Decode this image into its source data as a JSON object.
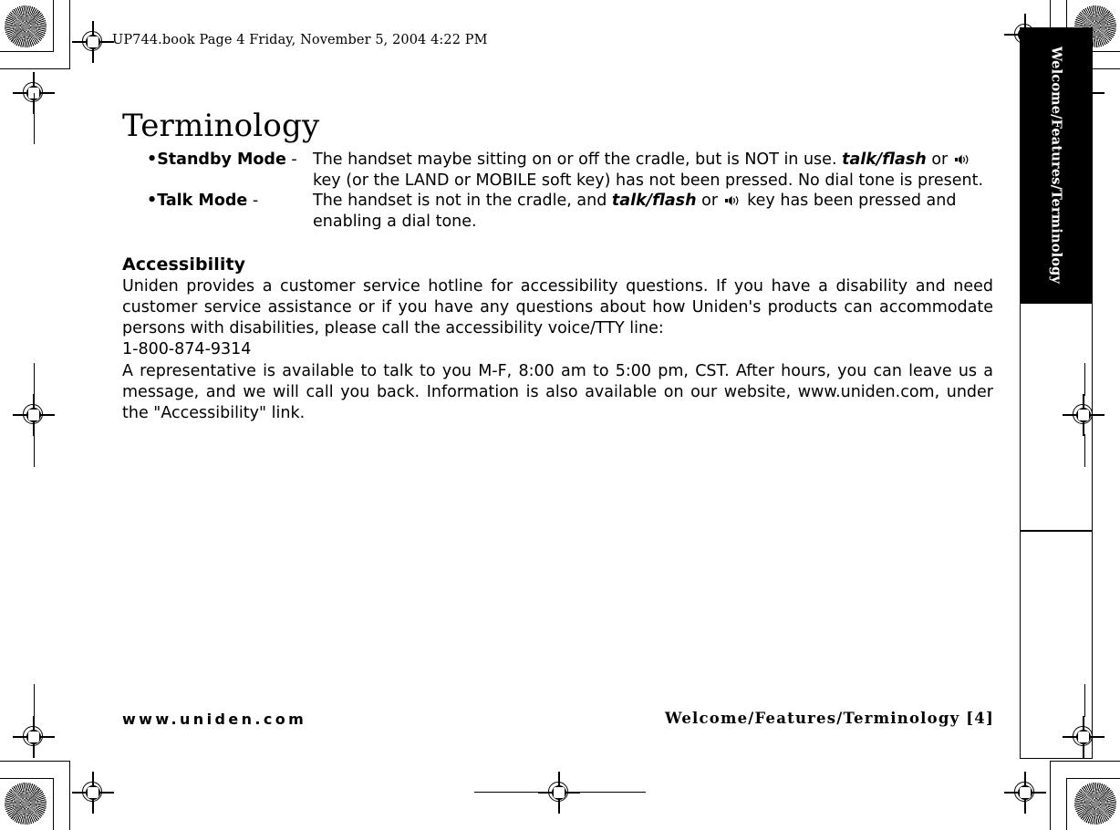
{
  "document": {
    "header_note": "UP744.book  Page 4  Friday, November 5, 2004  4:22 PM",
    "side_tab_label": "Welcome/Features/Terminology",
    "title": "Terminology"
  },
  "terminology": {
    "items": [
      {
        "bullet": "•",
        "term": "Standby Mode",
        "dash": " -",
        "body_part1": "The handset maybe sitting on or off the cradle, but is NOT in use. ",
        "body_emphasis": "talk/flash",
        "body_part2": " or ",
        "icon": "speaker-icon",
        "body_part3": " key (or the LAND or MOBILE soft key) has not been pressed. No dial tone is present."
      },
      {
        "bullet": "•",
        "term": "Talk Mode",
        "dash": " -",
        "body_part1": "The handset is not in the cradle, and ",
        "body_emphasis": "talk/flash",
        "body_part2": " or ",
        "icon": "speaker-icon",
        "body_part3": " key has been pressed and enabling a dial tone."
      }
    ]
  },
  "accessibility": {
    "heading": "Accessibility",
    "paragraph1": "Uniden provides a customer service hotline for accessibility questions. If you have a disability and need customer service assistance or if you have any questions about how Uniden's products can accommodate persons with disabilities, please call the accessibility voice/TTY line:",
    "phone": "1-800-874-9314",
    "paragraph2": "A representative is available to talk to you M-F, 8:00 am to 5:00 pm, CST. After hours, you can leave us a message, and we will call you back. Information is also available on our website, www.uniden.com, under the \"Accessibility\" link."
  },
  "footer": {
    "website": "www.uniden.com",
    "section_page": "Welcome/Features/Terminology [4]"
  },
  "colors": {
    "page_background": "#ffffff",
    "text": "#000000",
    "tab_background": "#000000",
    "tab_text": "#ffffff"
  }
}
